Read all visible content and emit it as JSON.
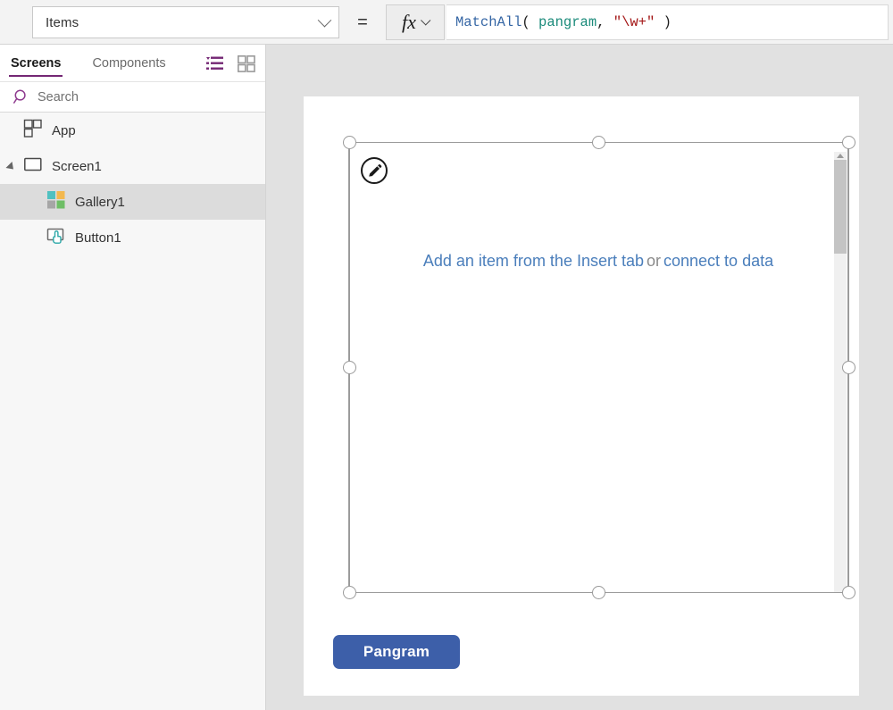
{
  "formula_bar": {
    "property_value": "Items",
    "equals": "=",
    "fx_label": "fx",
    "formula_tokens": [
      {
        "text": "MatchAll",
        "kind": "fn"
      },
      {
        "text": "( ",
        "kind": "paren"
      },
      {
        "text": "pangram",
        "kind": "ident"
      },
      {
        "text": ", ",
        "kind": "punct"
      },
      {
        "text": "\"\\w+\"",
        "kind": "string"
      },
      {
        "text": " )",
        "kind": "paren"
      }
    ],
    "formula_text": "MatchAll( pangram, \"\\w+\" )"
  },
  "left_panel": {
    "tabs": [
      {
        "label": "Screens",
        "active": true
      },
      {
        "label": "Components",
        "active": false
      }
    ],
    "view_icons": [
      {
        "name": "tree-view-icon",
        "color": "#742774",
        "active": true
      },
      {
        "name": "thumbnail-view-icon",
        "color": "#9a9a9a",
        "active": false
      }
    ],
    "search": {
      "placeholder": "Search"
    },
    "tree": [
      {
        "label": "App",
        "icon": "app-icon",
        "indent": 0,
        "selected": false,
        "expandable": false
      },
      {
        "label": "Screen1",
        "icon": "screen-icon",
        "indent": 0,
        "selected": false,
        "expandable": true
      },
      {
        "label": "Gallery1",
        "icon": "gallery-icon",
        "indent": 1,
        "selected": true,
        "expandable": false
      },
      {
        "label": "Button1",
        "icon": "button-icon",
        "indent": 1,
        "selected": false,
        "expandable": false
      }
    ]
  },
  "canvas": {
    "gallery": {
      "placeholder_link_1": "Add an item from the Insert tab",
      "placeholder_or": "or",
      "placeholder_link_2": "connect to data",
      "edit_icon": "pencil-icon",
      "scrollbar_present": true,
      "selected": true
    },
    "pangram_button": {
      "label": "Pangram",
      "background": "#3d5fa9",
      "text_color": "#ffffff"
    }
  },
  "colors": {
    "accent_purple": "#742774",
    "link_blue": "#4a7ebb",
    "button_blue": "#3d5fa9",
    "selection_gray": "#9b9b9b",
    "canvas_gray": "#e1e1e1",
    "row_highlight": "#dcdcdc"
  }
}
